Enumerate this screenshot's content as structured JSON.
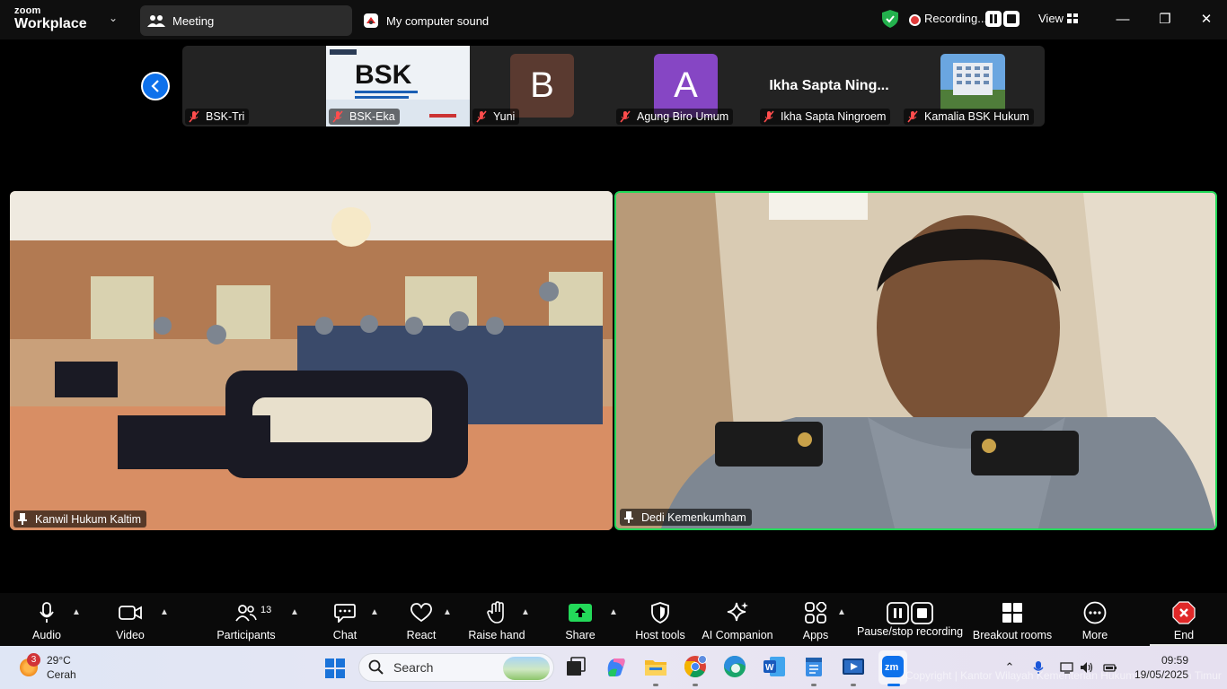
{
  "app": {
    "logo_line1": "zoom",
    "logo_line2": "Workplace"
  },
  "tabs": {
    "meeting": "Meeting",
    "sound": "My computer sound"
  },
  "recording": {
    "label": "Recording..."
  },
  "view": {
    "label": "View"
  },
  "window_controls": {
    "minimize": "—",
    "maximize": "❐",
    "close": "✕"
  },
  "colors": {
    "accent_blue": "#0e71eb",
    "active_speaker_border": "#23d959",
    "rec_red": "#e03a3a",
    "share_green": "#23d959",
    "end_red": "#e02828"
  },
  "strip": {
    "tiles": [
      {
        "name": "BSK-Tri",
        "type": "blank"
      },
      {
        "name": "BSK-Eka",
        "type": "slide",
        "slide_title": "BSK"
      },
      {
        "name": "Yuni",
        "type": "avatar",
        "letter": "B",
        "color": "#5a3a30"
      },
      {
        "name": "Agung Biro Umum",
        "type": "avatar",
        "letter": "A",
        "color": "#8646c4"
      },
      {
        "name": "Ikha Sapta Ningroem",
        "type": "text",
        "display": "Ikha Sapta Ning..."
      },
      {
        "name": "Kamalia BSK Hukum",
        "type": "photo"
      }
    ]
  },
  "videos": {
    "left": {
      "name": "Kanwil Hukum Kaltim"
    },
    "right": {
      "name": "Dedi Kemenkumham"
    }
  },
  "toolbar": {
    "audio": "Audio",
    "video": "Video",
    "participants": "Participants",
    "participants_count": "13",
    "chat": "Chat",
    "react": "React",
    "raise_hand": "Raise hand",
    "share": "Share",
    "host_tools": "Host tools",
    "ai_companion": "AI Companion",
    "apps": "Apps",
    "pause_stop_recording": "Pause/stop recording",
    "breakout_rooms": "Breakout rooms",
    "more": "More",
    "end": "End"
  },
  "taskbar": {
    "weather_badge": "3",
    "temperature": "29°C",
    "condition": "Cerah",
    "search_placeholder": "Search",
    "time": "09:59",
    "date": "19/05/2025",
    "watermark": "Copyright | Kantor Wilayah Kementerian Hukum Kalimantan Timur"
  }
}
